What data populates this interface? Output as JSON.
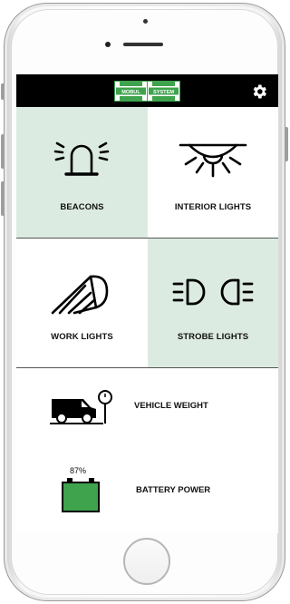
{
  "app": {
    "logo_left": "MOBUL",
    "logo_right": "SYSTEM",
    "brand_color": "#3fa34d",
    "settings_icon": "gear-icon"
  },
  "tiles": [
    {
      "label": "BEACONS",
      "icon": "beacon-icon",
      "active": true
    },
    {
      "label": "INTERIOR LIGHTS",
      "icon": "interior-light-icon",
      "active": false
    },
    {
      "label": "WORK LIGHTS",
      "icon": "work-light-icon",
      "active": false
    },
    {
      "label": "STROBE LIGHTS",
      "icon": "strobe-light-icon",
      "active": true
    }
  ],
  "status": {
    "vehicle_weight": {
      "label": "VEHICLE WEIGHT",
      "icon": "van-scale-icon"
    },
    "battery": {
      "label": "BATTERY POWER",
      "percent_text": "87%",
      "percent": 87,
      "icon": "battery-icon",
      "color": "#3fa34d"
    }
  },
  "colors": {
    "active_tile": "#dcebe1",
    "top_bar": "#000000"
  }
}
